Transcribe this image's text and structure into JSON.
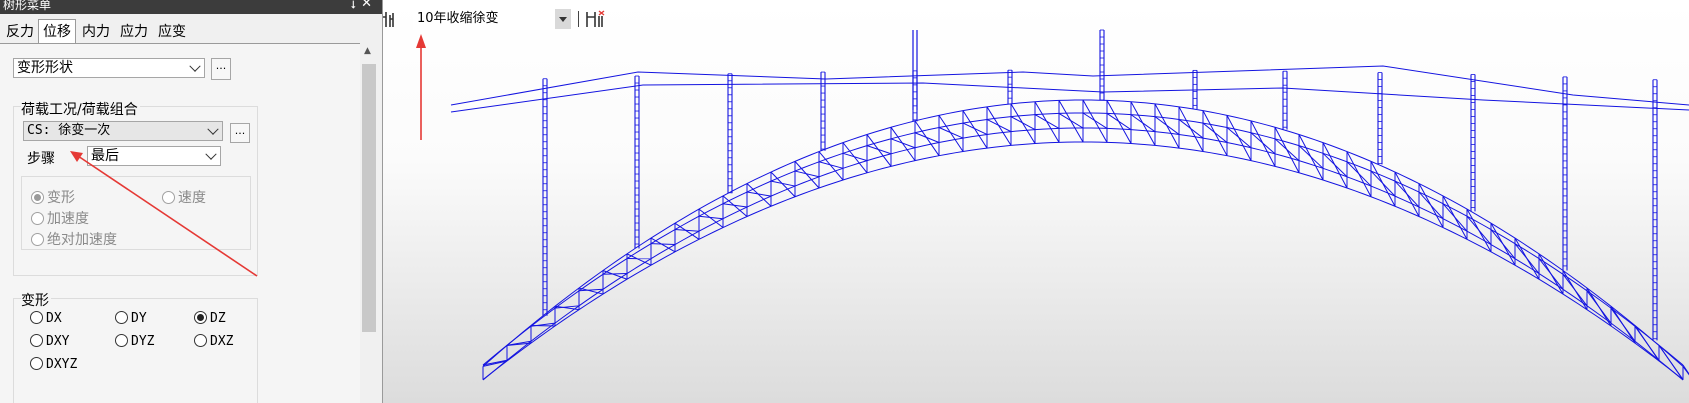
{
  "panel": {
    "title": "树形菜单",
    "pin_icon": "pin-icon",
    "close_icon": "close-icon",
    "tabs": [
      "反力",
      "位移",
      "内力",
      "应力",
      "应变"
    ],
    "active_tab": "位移",
    "result_type": {
      "value": "变形形状",
      "more": "..."
    },
    "load_group": {
      "title": "荷载工况/荷载组合",
      "case_value": "CS: 徐变一次",
      "more": "...",
      "step_label": "步骤",
      "step_value": "最后",
      "options": [
        "变形",
        "速度",
        "加速度",
        "绝对加速度"
      ],
      "selected_option": "变形"
    },
    "deform_group": {
      "title": "变形",
      "options": [
        "DX",
        "DY",
        "DZ",
        "DXY",
        "DYZ",
        "DXZ",
        "DXYZ"
      ],
      "selected": "DZ"
    }
  },
  "toolbar": {
    "load_case_value": "10年收缩徐变",
    "left_icon": "load-case-icon",
    "right_icon": "load-case-delete-icon"
  },
  "colors": {
    "model": "#1414e0",
    "annotation": "#e53935"
  }
}
